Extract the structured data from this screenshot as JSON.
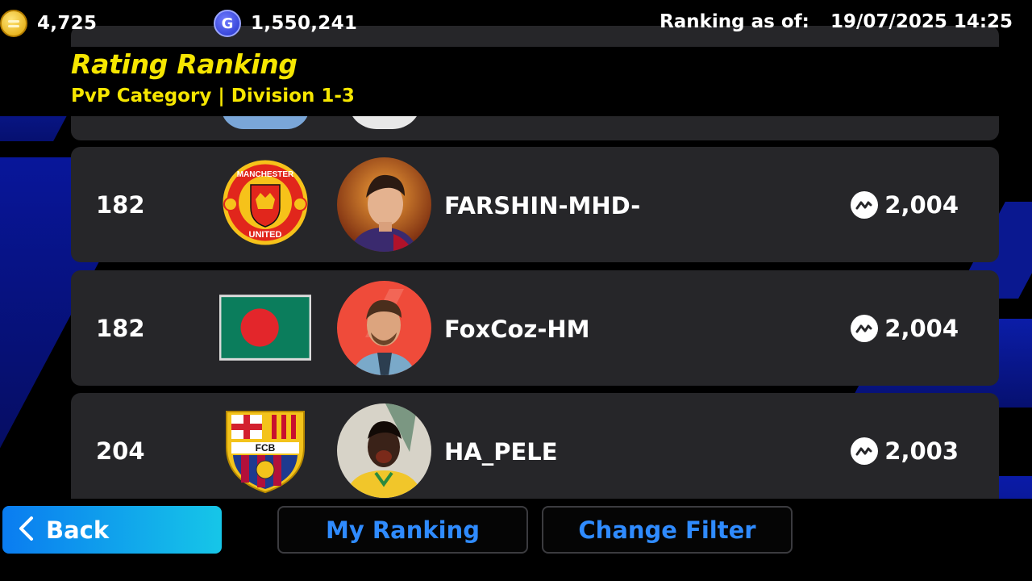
{
  "topbar": {
    "coins": "4,725",
    "gp": "1,550,241",
    "gp_icon_letter": "G",
    "ranking_label": "Ranking as of:",
    "ranking_date": "19/07/2025 14:25"
  },
  "header": {
    "title": "Rating Ranking",
    "subtitle": "PvP Category | Division 1-3"
  },
  "rows": [
    {
      "rank": "182",
      "club_icon": "manchester-united-crest",
      "avatar_icon": "player-portrait",
      "name": "FARSHIN-MHD-",
      "rating": "2,004"
    },
    {
      "rank": "182",
      "club_icon": "bangladesh-flag",
      "avatar_icon": "player-portrait",
      "name": "FoxCoz-HM",
      "rating": "2,004"
    },
    {
      "rank": "204",
      "club_icon": "fc-barcelona-crest",
      "avatar_icon": "player-portrait",
      "name": "HA_PELE",
      "rating": "2,003"
    }
  ],
  "crest_text": {
    "mu_top": "MANCHESTER",
    "mu_bottom": "UNITED",
    "fcb": "FCB"
  },
  "buttons": {
    "back": "Back",
    "my_ranking": "My Ranking",
    "change_filter": "Change Filter"
  },
  "colors": {
    "accent_yellow": "#f6e600",
    "button_blue": "#2f8bff",
    "back_gradient_start": "#0a7cf0",
    "back_gradient_end": "#16c6e8",
    "row_bg": "#262629"
  }
}
